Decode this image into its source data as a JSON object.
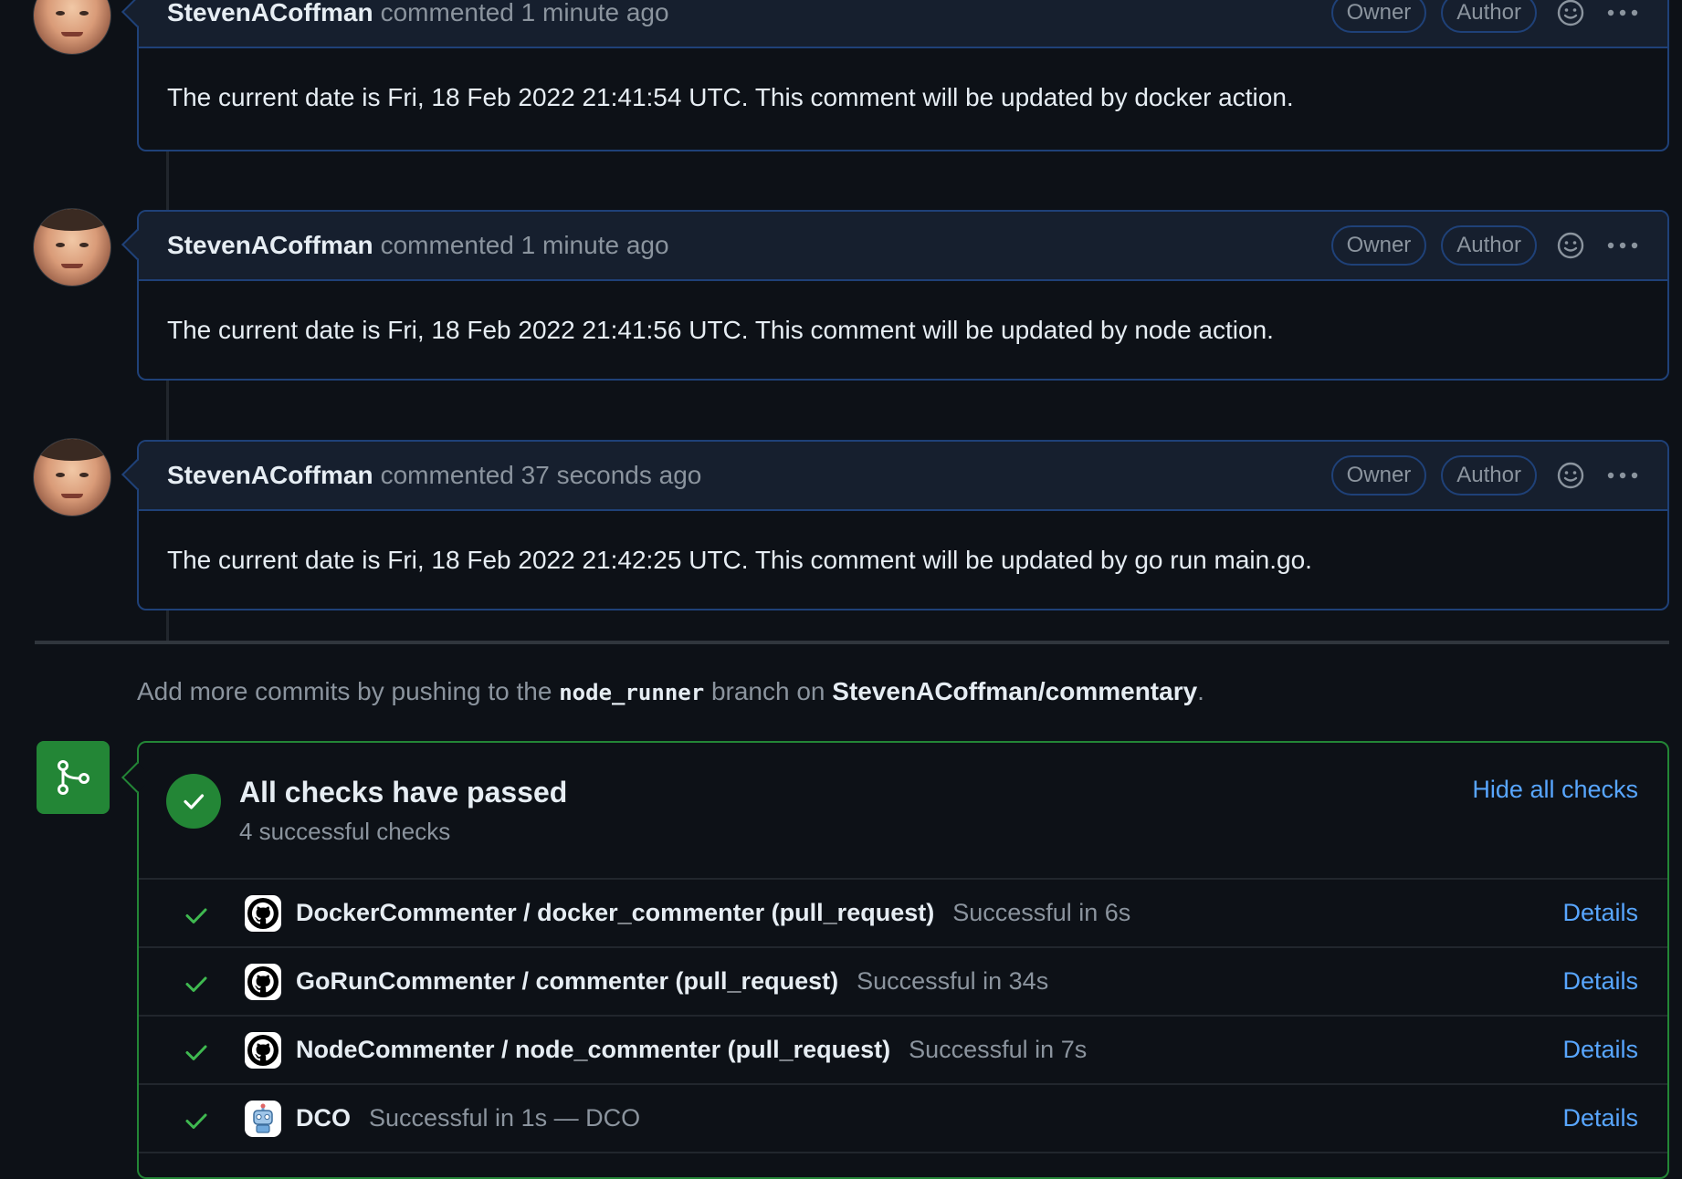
{
  "comments": [
    {
      "author": "StevenACoffman",
      "meta": "commented 1 minute ago",
      "badges": [
        "Owner",
        "Author"
      ],
      "body": "The current date is Fri, 18 Feb 2022 21:41:54 UTC. This comment will be updated by docker action."
    },
    {
      "author": "StevenACoffman",
      "meta": "commented 1 minute ago",
      "badges": [
        "Owner",
        "Author"
      ],
      "body": "The current date is Fri, 18 Feb 2022 21:41:56 UTC. This comment will be updated by node action."
    },
    {
      "author": "StevenACoffman",
      "meta": "commented 37 seconds ago",
      "badges": [
        "Owner",
        "Author"
      ],
      "body": "The current date is Fri, 18 Feb 2022 21:42:25 UTC. This comment will be updated by go run main.go."
    }
  ],
  "push_note": {
    "prefix": "Add more commits by pushing to the ",
    "branch": "node_runner",
    "middle": " branch on ",
    "repo": "StevenACoffman/commentary",
    "suffix": "."
  },
  "checks": {
    "title": "All checks have passed",
    "subtitle": "4 successful checks",
    "hide_label": "Hide all checks",
    "items": [
      {
        "name": "DockerCommenter / docker_commenter (pull_request)",
        "status": "Successful in 6s",
        "details": "Details",
        "icon": "github-icon"
      },
      {
        "name": "GoRunCommenter / commenter (pull_request)",
        "status": "Successful in 34s",
        "details": "Details",
        "icon": "github-icon"
      },
      {
        "name": "NodeCommenter / node_commenter (pull_request)",
        "status": "Successful in 7s",
        "details": "Details",
        "icon": "github-icon"
      },
      {
        "name": "DCO",
        "status": "Successful in 1s — DCO",
        "details": "Details",
        "icon": "dco-robot-icon"
      }
    ]
  },
  "colors": {
    "accent": "#58a6ff",
    "success": "#238636",
    "success_check": "#3fb950",
    "comment_border": "#1f4178"
  }
}
